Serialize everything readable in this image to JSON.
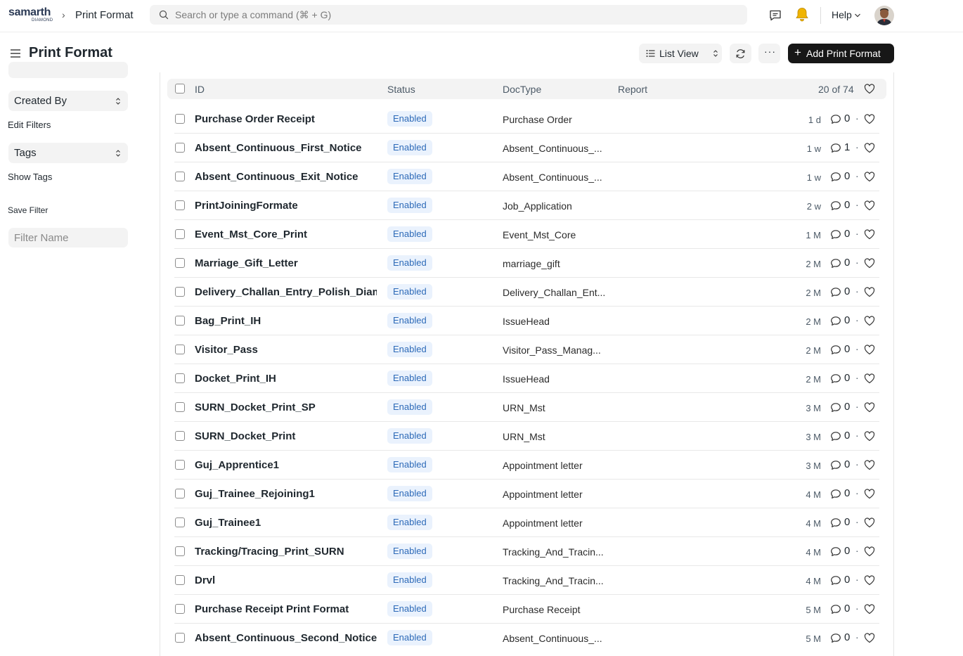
{
  "navbar": {
    "logo_text": "samarth",
    "logo_subtext": "DIAMOND",
    "breadcrumb_sep": "›",
    "breadcrumb": "Print Format",
    "search_placeholder": "Search or type a command (⌘ + G)",
    "help_label": "Help"
  },
  "page": {
    "title": "Print Format",
    "view_label": "List View",
    "more_label": "···",
    "add_label": "Add Print Format",
    "add_icon": "+"
  },
  "sidebar": {
    "created_by_label": "Created By",
    "edit_filters_label": "Edit Filters",
    "tags_label": "Tags",
    "show_tags_label": "Show Tags",
    "save_filter_label": "Save Filter",
    "filter_name_placeholder": "Filter Name"
  },
  "list": {
    "headers": {
      "id": "ID",
      "status": "Status",
      "doctype": "DocType",
      "report": "Report"
    },
    "count": "20 of 74",
    "rows": [
      {
        "name": "Purchase Order Receipt",
        "status": "Enabled",
        "doctype": "Purchase Order",
        "modified": "1 d",
        "comments": "0"
      },
      {
        "name": "Absent_Continuous_First_Notice",
        "status": "Enabled",
        "doctype": "Absent_Continuous_...",
        "modified": "1 w",
        "comments": "1"
      },
      {
        "name": "Absent_Continuous_Exit_Notice",
        "status": "Enabled",
        "doctype": "Absent_Continuous_...",
        "modified": "1 w",
        "comments": "0"
      },
      {
        "name": "PrintJoiningFormate",
        "status": "Enabled",
        "doctype": "Job_Application",
        "modified": "2 w",
        "comments": "0"
      },
      {
        "name": "Event_Mst_Core_Print",
        "status": "Enabled",
        "doctype": "Event_Mst_Core",
        "modified": "1 M",
        "comments": "0"
      },
      {
        "name": "Marriage_Gift_Letter",
        "status": "Enabled",
        "doctype": "marriage_gift",
        "modified": "2 M",
        "comments": "0"
      },
      {
        "name": "Delivery_Challan_Entry_Polish_Diamond",
        "status": "Enabled",
        "doctype": "Delivery_Challan_Ent...",
        "modified": "2 M",
        "comments": "0"
      },
      {
        "name": "Bag_Print_IH",
        "status": "Enabled",
        "doctype": "IssueHead",
        "modified": "2 M",
        "comments": "0"
      },
      {
        "name": "Visitor_Pass",
        "status": "Enabled",
        "doctype": "Visitor_Pass_Manag...",
        "modified": "2 M",
        "comments": "0"
      },
      {
        "name": "Docket_Print_IH",
        "status": "Enabled",
        "doctype": "IssueHead",
        "modified": "2 M",
        "comments": "0"
      },
      {
        "name": "SURN_Docket_Print_SP",
        "status": "Enabled",
        "doctype": "URN_Mst",
        "modified": "3 M",
        "comments": "0"
      },
      {
        "name": "SURN_Docket_Print",
        "status": "Enabled",
        "doctype": "URN_Mst",
        "modified": "3 M",
        "comments": "0"
      },
      {
        "name": "Guj_Apprentice1",
        "status": "Enabled",
        "doctype": "Appointment letter",
        "modified": "3 M",
        "comments": "0"
      },
      {
        "name": "Guj_Trainee_Rejoining1",
        "status": "Enabled",
        "doctype": "Appointment letter",
        "modified": "4 M",
        "comments": "0"
      },
      {
        "name": "Guj_Trainee1",
        "status": "Enabled",
        "doctype": "Appointment letter",
        "modified": "4 M",
        "comments": "0"
      },
      {
        "name": "Tracking/Tracing_Print_SURN",
        "status": "Enabled",
        "doctype": "Tracking_And_Tracin...",
        "modified": "4 M",
        "comments": "0"
      },
      {
        "name": "Drvl",
        "status": "Enabled",
        "doctype": "Tracking_And_Tracin...",
        "modified": "4 M",
        "comments": "0"
      },
      {
        "name": "Purchase Receipt Print Format",
        "status": "Enabled",
        "doctype": "Purchase Receipt",
        "modified": "5 M",
        "comments": "0"
      },
      {
        "name": "Absent_Continuous_Second_Notice",
        "status": "Enabled",
        "doctype": "Absent_Continuous_...",
        "modified": "5 M",
        "comments": "0"
      }
    ]
  },
  "colors": {
    "badge_bg": "#eaf2fd",
    "badge_text": "#2d6ab8",
    "primary_button": "#171717",
    "bell": "#f0b400"
  },
  "icons": {
    "search": "search-icon",
    "chat": "chat-icon",
    "bell": "bell-icon",
    "menu": "hamburger-icon",
    "refresh": "refresh-icon",
    "comment": "comment-icon",
    "like": "heart-icon"
  }
}
